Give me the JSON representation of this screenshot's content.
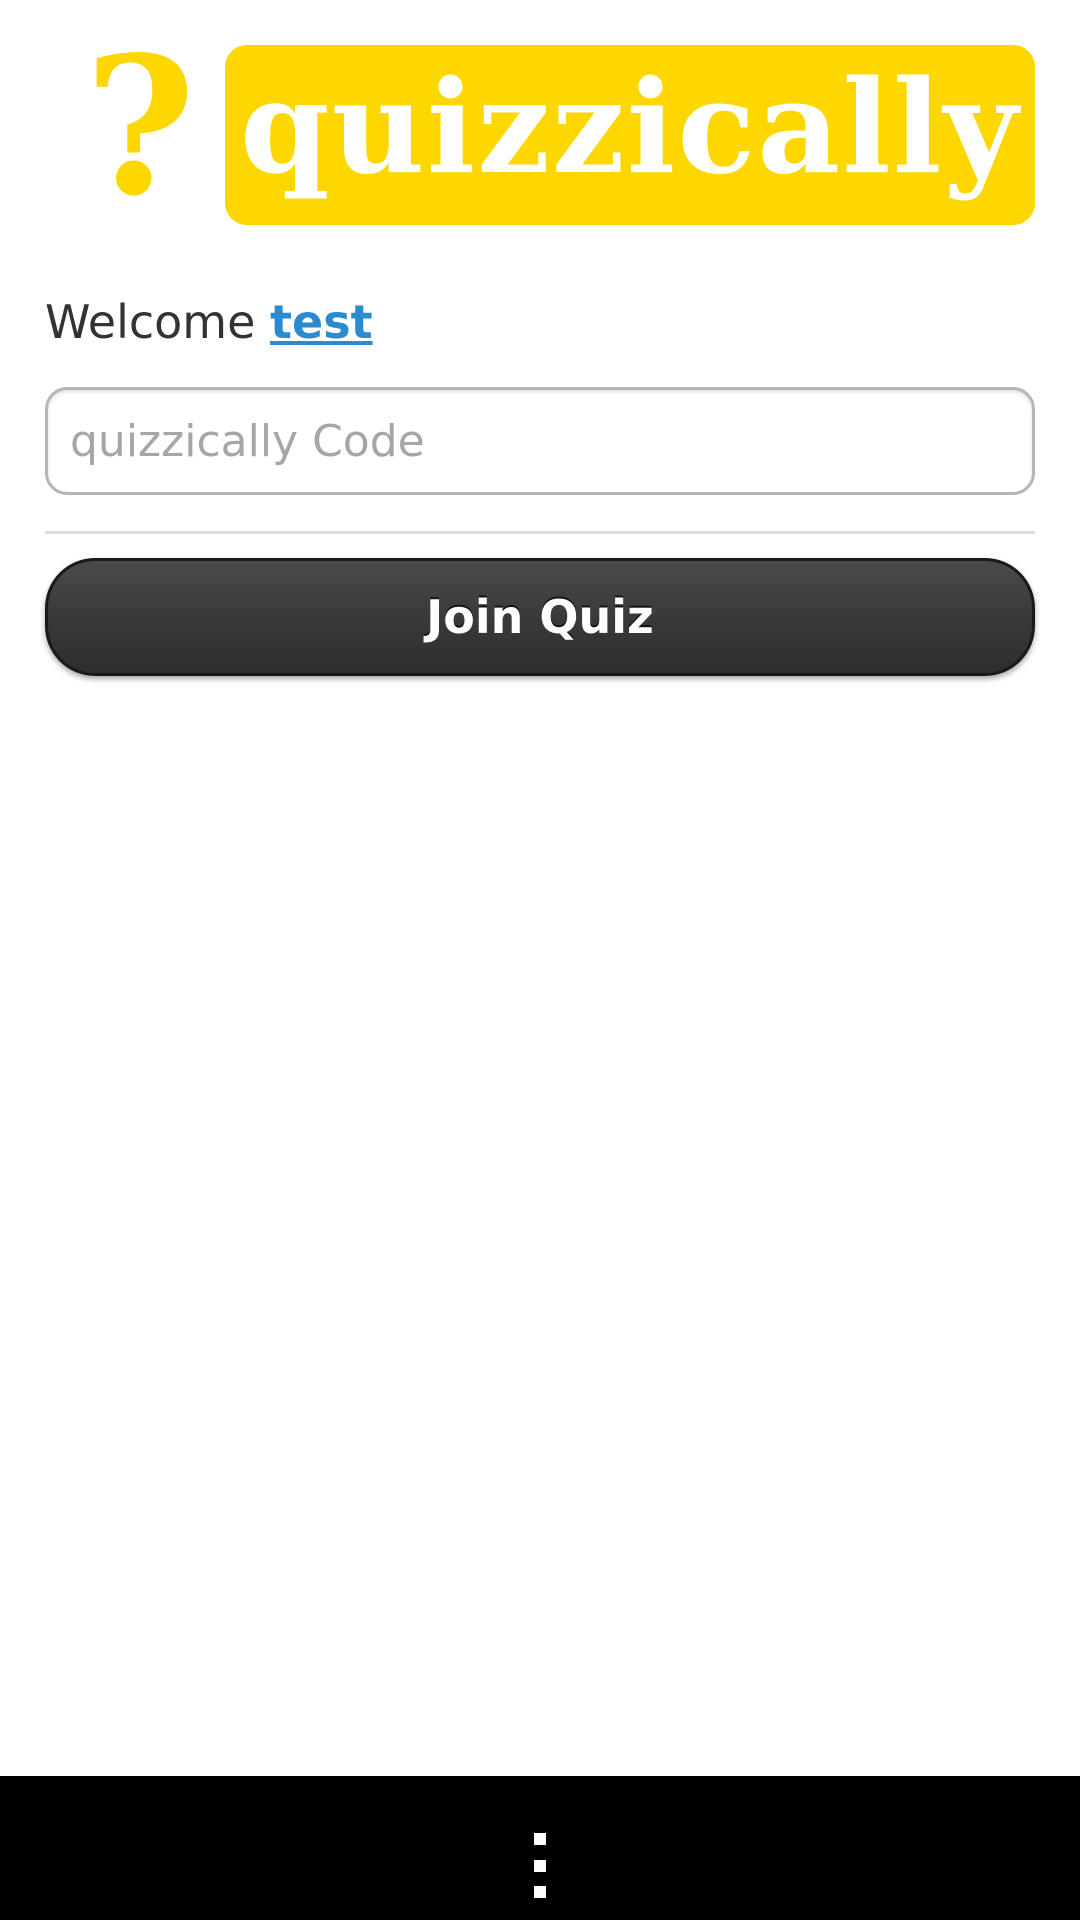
{
  "app": {
    "logo_symbol": "?",
    "logo_text": "quizzically",
    "brand_color": "#FFD700"
  },
  "welcome": {
    "prefix": "Welcome ",
    "username": "test",
    "link_color": "#2A8BD0"
  },
  "code_input": {
    "placeholder": "quizzically Code",
    "value": ""
  },
  "join_button": {
    "label": "Join Quiz"
  },
  "nav_bar": {
    "menu_icon": "overflow-menu-icon"
  }
}
